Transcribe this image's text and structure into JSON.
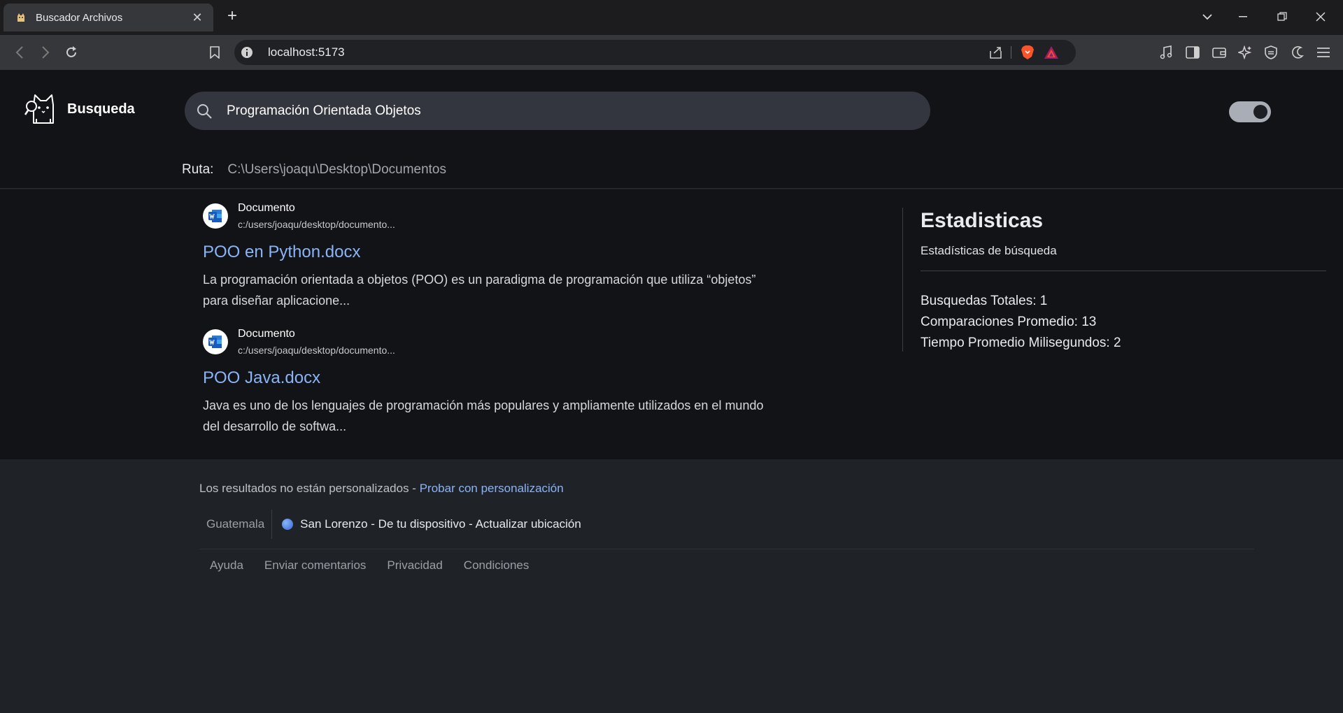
{
  "browser": {
    "tab_title": "Buscador Archivos",
    "url": "localhost:5173"
  },
  "app": {
    "logo_text": "Busqueda",
    "search_value": "Programación Orientada Objetos",
    "ruta_label": "Ruta:",
    "ruta_value": "C:\\Users\\joaqu\\Desktop\\Documentos",
    "dark_mode": true
  },
  "results": [
    {
      "source": "Documento",
      "path": "c:/users/joaqu/desktop/documento...",
      "title": "POO en Python.docx",
      "snippet": "La programación orientada a objetos (POO) es un paradigma de programación que utiliza “objetos” para diseñar aplicacione..."
    },
    {
      "source": "Documento",
      "path": "c:/users/joaqu/desktop/documento...",
      "title": "POO Java.docx",
      "snippet": "Java es uno de los lenguajes de programación más populares y ampliamente utilizados en el mundo del desarrollo de softwa..."
    }
  ],
  "stats": {
    "title": "Estadisticas",
    "subtitle": "Estadísticas de búsqueda",
    "lines": [
      "Busquedas Totales: 1",
      "Comparaciones Promedio: 13",
      "Tiempo Promedio Milisegundos: 2"
    ]
  },
  "footer": {
    "personal_text": "Los resultados no están personalizados - ",
    "personal_link": "Probar con personalización",
    "country": "Guatemala",
    "location": "San Lorenzo - De tu dispositivo - Actualizar ubicación",
    "links": [
      "Ayuda",
      "Enviar comentarios",
      "Privacidad",
      "Condiciones"
    ]
  },
  "colors": {
    "accent_link": "#8ab4f8",
    "page_bg": "#121317",
    "footer_bg": "#1f2227"
  }
}
